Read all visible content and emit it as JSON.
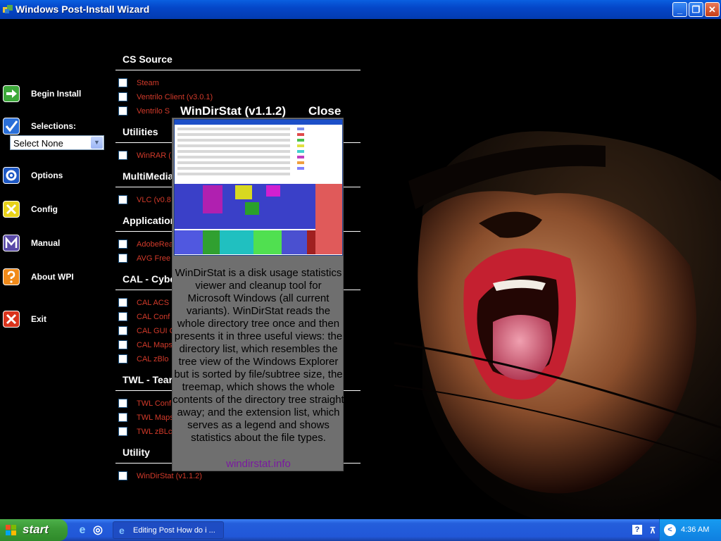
{
  "window": {
    "title": "Windows Post-Install Wizard",
    "controls": [
      "minimize",
      "maximize",
      "close"
    ]
  },
  "menu": {
    "items": [
      {
        "label": "Begin Install",
        "icon": "arrow-right-icon"
      },
      {
        "label": "Selections:",
        "icon": "checkmark-icon"
      },
      {
        "label": "Options",
        "icon": "gear-icon"
      },
      {
        "label": "Config",
        "icon": "config-x-icon"
      },
      {
        "label": "Manual",
        "icon": "manual-m-icon"
      },
      {
        "label": "About WPI",
        "icon": "question-icon"
      },
      {
        "label": "Exit",
        "icon": "exit-x-icon"
      }
    ],
    "selections_value": "Select None"
  },
  "sections": [
    {
      "title": "CS Source",
      "items": [
        "Steam",
        "Ventrilo Client (v3.0.1)",
        "Ventrilo S"
      ]
    },
    {
      "title": "Utilities",
      "items": [
        "WinRAR ("
      ]
    },
    {
      "title": "MultiMedia",
      "items": [
        "VLC (v0.8"
      ]
    },
    {
      "title": "Application",
      "items": [
        "AdobeRea",
        "AVG Free"
      ]
    },
    {
      "title": "CAL - Cybe",
      "items": [
        "CAL ACS",
        "CAL Conf",
        "CAL GUI C",
        "CAL Maps",
        "CAL zBlo"
      ]
    },
    {
      "title": "TWL - Tear",
      "items": [
        "TWL Conf",
        "TWL Maps",
        "TWL zBLc"
      ]
    },
    {
      "title": "Utility",
      "items": [
        "WinDirStat (v1.1.2)"
      ]
    }
  ],
  "popup": {
    "title": "WinDirStat (v1.1.2)",
    "close_label": "Close",
    "description": "WinDirStat is a disk usage statistics viewer and cleanup tool for Microsoft Windows (all current variants). WinDirStat reads the whole directory tree once and then presents it in three useful views: the directory list, which resembles the tree view of the Windows Explorer but is sorted by file/subtree size, the treemap, which shows the whole contents of the directory tree straight away; and the extension list, which serves as a legend and shows statistics about the file types.",
    "link": "windirstat.info"
  },
  "taskbar": {
    "start_label": "start",
    "task_label": "Editing Post How do i ...",
    "clock": "4:36 AM"
  },
  "colors": {
    "accent": "#0a5fe0",
    "program_text": "#d23a2a",
    "popup_bg": "#6f6f6f",
    "link": "#7a1aa0"
  }
}
